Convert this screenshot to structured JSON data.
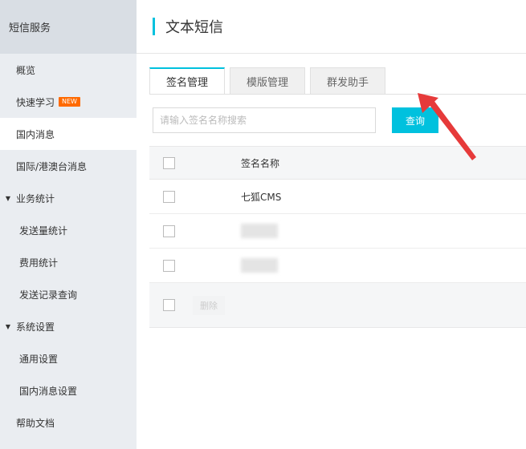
{
  "sidebar": {
    "header": "短信服务",
    "items": [
      {
        "label": "概览"
      },
      {
        "label": "快速学习",
        "badge": "NEW"
      },
      {
        "label": "国内消息"
      },
      {
        "label": "国际/港澳台消息"
      },
      {
        "label": "业务统计"
      },
      {
        "label": "发送量统计"
      },
      {
        "label": "费用统计"
      },
      {
        "label": "发送记录查询"
      },
      {
        "label": "系统设置"
      },
      {
        "label": "通用设置"
      },
      {
        "label": "国内消息设置"
      },
      {
        "label": "帮助文档"
      }
    ]
  },
  "page": {
    "title": "文本短信"
  },
  "tabs": [
    {
      "label": "签名管理"
    },
    {
      "label": "模版管理"
    },
    {
      "label": "群发助手"
    }
  ],
  "search": {
    "placeholder": "请输入签名名称搜索",
    "button": "查询"
  },
  "table": {
    "header": "签名名称",
    "rows": [
      {
        "name": "七狐CMS"
      },
      {
        "name": ""
      },
      {
        "name": ""
      }
    ],
    "delete_label": "删除"
  },
  "colors": {
    "accent": "#00c1de",
    "badge": "#ff6a00",
    "arrow": "#e63a3a"
  }
}
